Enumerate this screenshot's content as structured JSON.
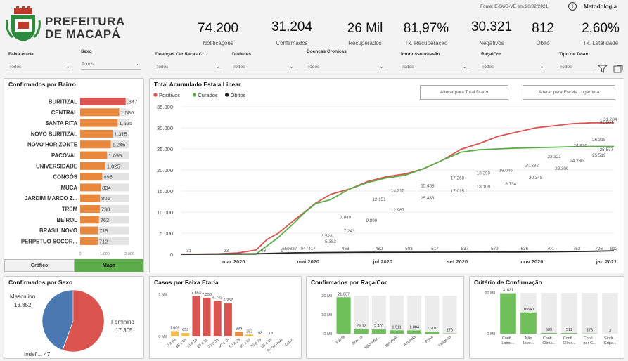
{
  "header": {
    "logo_line1": "PREFEITURA",
    "logo_line2": "DE MACAPÁ",
    "source": "Fonte: E-SUS-VE em 20/02/2021",
    "metodologia": "Metodologia"
  },
  "kpis": [
    {
      "value": "74.200",
      "label": "Notificações"
    },
    {
      "value": "31.204",
      "label": "Confirmados"
    },
    {
      "value": "26 Mil",
      "label": "Recuperados"
    },
    {
      "value": "81,97%",
      "label": "Tx. Recuperação"
    },
    {
      "value": "30.321",
      "label": "Negativos"
    },
    {
      "value": "812",
      "label": "Óbito"
    },
    {
      "value": "2,60%",
      "label": "Tx. Letalidade"
    }
  ],
  "filters": [
    {
      "label": "Faixa etaria",
      "value": "Todos"
    },
    {
      "label": "Sexo",
      "value": "Todos"
    },
    {
      "label": "Doenças Cardiacas Cr...",
      "value": "Todos"
    },
    {
      "label": "Diabetes",
      "value": "Todos"
    },
    {
      "label": "Doenças Cronicas",
      "value": "Todos"
    },
    {
      "label": "Imunossupressão",
      "value": "Todos"
    },
    {
      "label": "Raça/Cor",
      "value": "Todos"
    },
    {
      "label": "Tipo de Teste",
      "value": "Todos"
    }
  ],
  "bairro": {
    "title": "Confirmados por Bairro",
    "tab_grafico": "Gráfico",
    "tab_mapa": "Mapa",
    "colors": {
      "top": "#d9534f",
      "bar": "#e8883d",
      "track": "#e3e3e3"
    },
    "chart_data": {
      "type": "bar",
      "categories": [
        "BURITIZAL",
        "CENTRAL",
        "SANTA RITA",
        "NOVO BURITIZAL",
        "NOVO HORIZONTE",
        "PACOVAL",
        "UNIVERSIDADE",
        "CONGÓS",
        "MUCA",
        "JARDIM MARCO Z...",
        "TREM",
        "BEIROL",
        "BRASIL NOVO",
        "PERPETUO SOCOR..."
      ],
      "values": [
        1847,
        1586,
        1525,
        1315,
        1245,
        1095,
        1025,
        895,
        834,
        805,
        798,
        762,
        719,
        712
      ],
      "labels": [
        ".847",
        "1.586",
        "1.525",
        "1.315",
        "1.245",
        "1.095",
        "1.025",
        "895",
        "834",
        "805",
        "798",
        "762",
        "719",
        "712"
      ],
      "xticks": [
        "0",
        "1.000",
        "2.000"
      ],
      "xlim": [
        0,
        2000
      ]
    }
  },
  "acumulado": {
    "title": "Total Acumulado Estala Linear",
    "btn_diario": "Alterar para Total Diário",
    "btn_log": "Alterar para Escala Logarítma",
    "colors": {
      "positivos": "#d9534f",
      "curados": "#5cad4a",
      "obitos": "#222222"
    },
    "chart_data": {
      "type": "line",
      "ylim": [
        0,
        35000
      ],
      "yticks": [
        "0",
        "5.000",
        "10.000",
        "15.000",
        "20.000",
        "25.000",
        "30.000",
        "35.000"
      ],
      "xticks": [
        "mar 2020",
        "mai 2020",
        "jul 2020",
        "set 2020",
        "nov 2020",
        "jan 2021"
      ],
      "legend": [
        "Positivos",
        "Curados",
        "Óbitos"
      ],
      "series": [
        {
          "name": "Positivos",
          "x": [
            0,
            0.5,
            1,
            1.5,
            2,
            2.3,
            2.6,
            3,
            3.3,
            3.6,
            4,
            4.5,
            5,
            5.5,
            6,
            6.5,
            7,
            7.5,
            8,
            8.5,
            9,
            9.5,
            10,
            10.5,
            11,
            11.6
          ],
          "values": [
            31,
            40,
            100,
            300,
            1000,
            3528,
            5000,
            7940,
            10000,
            12151,
            14215,
            15458,
            17268,
            18393,
            19046,
            20282,
            22321,
            24920,
            26315,
            28000,
            29000,
            30000,
            30500,
            31000,
            31204,
            31204
          ]
        },
        {
          "name": "Curados",
          "x": [
            0,
            2,
            2.3,
            2.6,
            3,
            3.3,
            3.6,
            4,
            4.5,
            5,
            5.5,
            6,
            6.5,
            7,
            7.5,
            8,
            8.5,
            9,
            9.5,
            10,
            10.5,
            11,
            11.6
          ],
          "values": [
            0,
            0,
            2000,
            4000,
            7243,
            9890,
            12000,
            12967,
            15433,
            17015,
            18109,
            18734,
            20348,
            22309,
            24230,
            24800,
            25000,
            25200,
            25300,
            25400,
            25519,
            25577,
            25577
          ]
        },
        {
          "name": "Óbitos",
          "x": [
            0,
            2,
            3,
            4,
            5,
            6,
            7,
            8,
            9,
            10,
            11,
            11.6
          ],
          "values": [
            0,
            100,
            337,
            417,
            463,
            482,
            503,
            517,
            537,
            579,
            701,
            812
          ]
        }
      ],
      "annotations": {
        "positivos": [
          "31",
          "23",
          "53",
          "9",
          "547",
          "3.528",
          "7.940",
          "12.151",
          "14.215",
          "15.458",
          "17.268",
          "18.393",
          "19.046",
          "20.282",
          "22.321",
          "24.920",
          "26.315",
          "31.204",
          "31.204"
        ],
        "curados": [
          "5.383",
          "7.243",
          "9.890",
          "12.967",
          "15.433",
          "17.015",
          "18.109",
          "18.734",
          "20.348",
          "22.309",
          "24.230",
          "25.519",
          "25.577"
        ],
        "obitos": [
          "659",
          "337",
          "417",
          "463",
          "482",
          "503",
          "517",
          "537",
          "579",
          "636",
          "701",
          "753",
          "796",
          "812"
        ]
      }
    }
  },
  "sexo": {
    "title": "Confirmados por Sexo",
    "colors": {
      "masculino": "#4a78b0",
      "feminino": "#d9534f"
    },
    "chart_data": {
      "type": "pie",
      "categories": [
        "Masculino",
        "Feminino",
        "Indefi..."
      ],
      "values": [
        13852,
        17305,
        47
      ],
      "labels": [
        "13.852",
        "17.305",
        "47"
      ]
    }
  },
  "faixa": {
    "title": "Casos por Faixa Etaria",
    "colors": {
      "hi": "#d9534f",
      "mid": "#e8883d",
      "low": "#f0b94a"
    },
    "chart_data": {
      "type": "bar",
      "categories": [
        "0 a 04",
        "05 a 09",
        "10 a 19",
        "20 a 29",
        "30 a 39",
        "40 a 49",
        "50 a 59",
        "60 a 69",
        "70 a 79",
        "80 a 89",
        "90 ou mais",
        "Outro"
      ],
      "values": [
        1009,
        659,
        7653,
        7350,
        6743,
        6257,
        889,
        352,
        93,
        13,
        0,
        0
      ],
      "labels": [
        "1.009",
        "659",
        "7.653",
        "7.350",
        "6.743",
        "6.257",
        "889",
        "352",
        "93",
        "13",
        "",
        ""
      ],
      "ylabels": [
        "0 Mil",
        "5 Mil"
      ],
      "ylim": [
        0,
        8000
      ]
    }
  },
  "raca": {
    "title": "Confirmados por Raça/Cor",
    "colors": {
      "bar": "#6fc05a"
    },
    "chart_data": {
      "type": "bar",
      "categories": [
        "Parda",
        "Branca",
        "Não Infor...",
        "Ignorado",
        "Amarela",
        "Preta",
        "Indígena"
      ],
      "values": [
        21037,
        2612,
        2401,
        1911,
        1884,
        1201,
        176
      ],
      "labels": [
        "21.037",
        "2.612",
        "2.401",
        "1.911",
        "1.884",
        "1.201",
        "176"
      ],
      "ylabels": [
        "0 Mil",
        "10 Mil",
        "20 Mil"
      ],
      "ylim": [
        0,
        22000
      ]
    }
  },
  "criterio": {
    "title": "Critério de Confirmação",
    "colors": {
      "bar": "#6fc05a"
    },
    "chart_data": {
      "type": "bar",
      "categories": [
        "Confi... Labor...",
        "Não Infor...",
        "Confi... Clínic...",
        "Confi... Clínic...",
        "Confi... por C...",
        "Sindr... Gripa..."
      ],
      "values": [
        31631,
        16640,
        583,
        511,
        173,
        3
      ],
      "labels": [
        "31631",
        "16640",
        "583",
        "511",
        "173",
        "3"
      ],
      "ylabels": [
        "0 Mil",
        "20 Mil"
      ],
      "ylim": [
        0,
        32000
      ]
    }
  }
}
